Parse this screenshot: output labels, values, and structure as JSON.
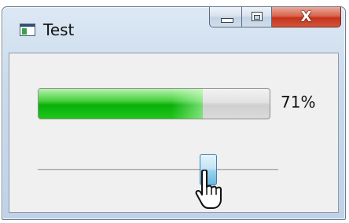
{
  "window": {
    "title": "Test",
    "caption_buttons": {
      "minimize_icon": "minimize-icon",
      "maximize_icon": "maximize-icon",
      "close_icon": "close-icon",
      "close_glyph": "X"
    }
  },
  "progress": {
    "value_fraction": 0.71,
    "label": "71%"
  },
  "slider": {
    "value_fraction": 0.71
  },
  "colors": {
    "progress_fill": "#08b008",
    "close_button": "#c5341b",
    "thumb": "#6ab7e0"
  },
  "cursor": {
    "icon": "hand-pointer-icon"
  }
}
